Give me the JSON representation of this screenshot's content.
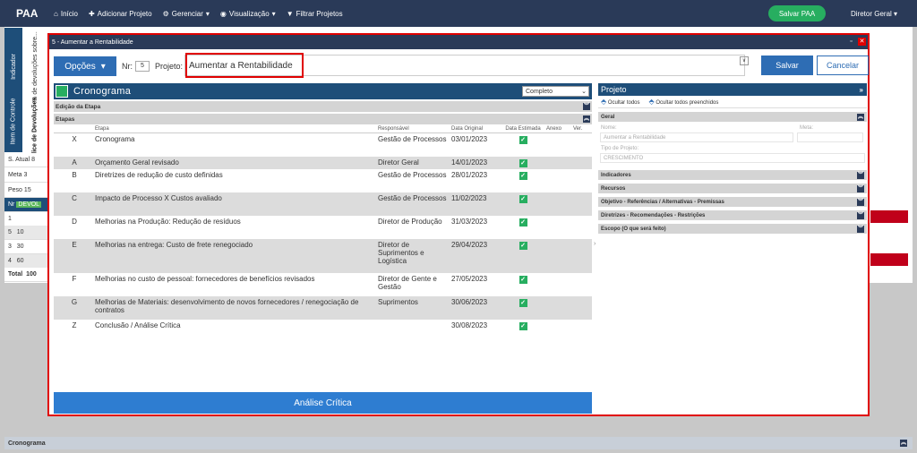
{
  "nav": {
    "brand": "PAA",
    "items": [
      "Início",
      "Adicionar Projeto",
      "Gerenciar",
      "Visualização",
      "Filtrar Projetos"
    ],
    "save_button": "Salvar PAA",
    "user": "Diretor Geral"
  },
  "background": {
    "vtab_indicador": "Indicador",
    "vtab_devolucoes": "% de devoluções sobre...",
    "vtab_item": "Item de Controle",
    "vtab_indice": "Índice de Devoluções",
    "rows": [
      {
        "label": "S. Atual",
        "value": "8"
      },
      {
        "label": "Meta",
        "value": "3"
      },
      {
        "label": "Peso",
        "value": "15"
      }
    ],
    "nr_header": "Nr",
    "devol_label": "DEVOL",
    "table": [
      {
        "nr": "1",
        "val": ""
      },
      {
        "nr": "5",
        "val": "10"
      },
      {
        "nr": "3",
        "val": "30"
      },
      {
        "nr": "4",
        "val": "60"
      },
      {
        "nr": "Total",
        "val": "100"
      }
    ],
    "bottom_label": "Cronograma"
  },
  "modal": {
    "title": "5 - Aumentar a Rentabilidade",
    "options_label": "Opções",
    "nr_label": "Nr:",
    "nr_value": "5",
    "project_label": "Projeto:",
    "project_value": "Aumentar a Rentabilidade",
    "save_label": "Salvar",
    "cancel_label": "Cancelar"
  },
  "cronograma": {
    "title": "Cronograma",
    "filter": "Completo",
    "edicao_label": "Edição da Etapa",
    "etapas_label": "Etapas",
    "columns": [
      "Etapa",
      "Responsável",
      "Data Original",
      "Data Estimada",
      "Anexo",
      "Ver."
    ],
    "rows": [
      {
        "id": "X",
        "etapa": "Cronograma",
        "resp": "Gestão de Processos",
        "data": "03/01/2023"
      },
      {
        "id": "A",
        "etapa": "Orçamento Geral revisado",
        "resp": "Diretor Geral",
        "data": "14/01/2023"
      },
      {
        "id": "B",
        "etapa": "Diretrizes de redução de custo definidas",
        "resp": "Gestão de Processos",
        "data": "28/01/2023"
      },
      {
        "id": "C",
        "etapa": "Impacto de Processo X Custos avaliado",
        "resp": "Gestão de Processos",
        "data": "11/02/2023"
      },
      {
        "id": "D",
        "etapa": "Melhorias na Produção: Redução de resíduos",
        "resp": "Diretor de Produção",
        "data": "31/03/2023"
      },
      {
        "id": "E",
        "etapa": "Melhorias na entrega: Custo de frete renegociado",
        "resp": "Diretor de Suprimentos e Logística",
        "data": "29/04/2023"
      },
      {
        "id": "F",
        "etapa": "Melhorias no custo de pessoal: fornecedores de benefícios revisados",
        "resp": "Diretor de Gente e Gestão",
        "data": "27/05/2023"
      },
      {
        "id": "G",
        "etapa": "Melhorias de Materiais: desenvolvimento de novos fornecedores / renegociação de contratos",
        "resp": "Suprimentos",
        "data": "30/06/2023"
      },
      {
        "id": "Z",
        "etapa": "Conclusão / Análise Crítica",
        "resp": "",
        "data": "30/08/2023"
      }
    ],
    "analise_button": "Análise Crítica"
  },
  "projeto": {
    "title": "Projeto",
    "hide_all": "Ocultar todos",
    "hide_filled": "Ocultar todos preenchidos",
    "geral_label": "Geral",
    "nome_label": "Nome:",
    "meta_label": "Meta:",
    "nome_value": "Aumentar a Rentabilidade",
    "tipo_label": "Tipo de Projeto:",
    "tipo_value": "CRESCIMENTO",
    "sections": [
      "Indicadores",
      "Recursos",
      "Objetivo - Referências / Alternativas - Premissas",
      "Diretrizes - Recomendações - Restrições",
      "Escopo (O que será feito)"
    ]
  }
}
